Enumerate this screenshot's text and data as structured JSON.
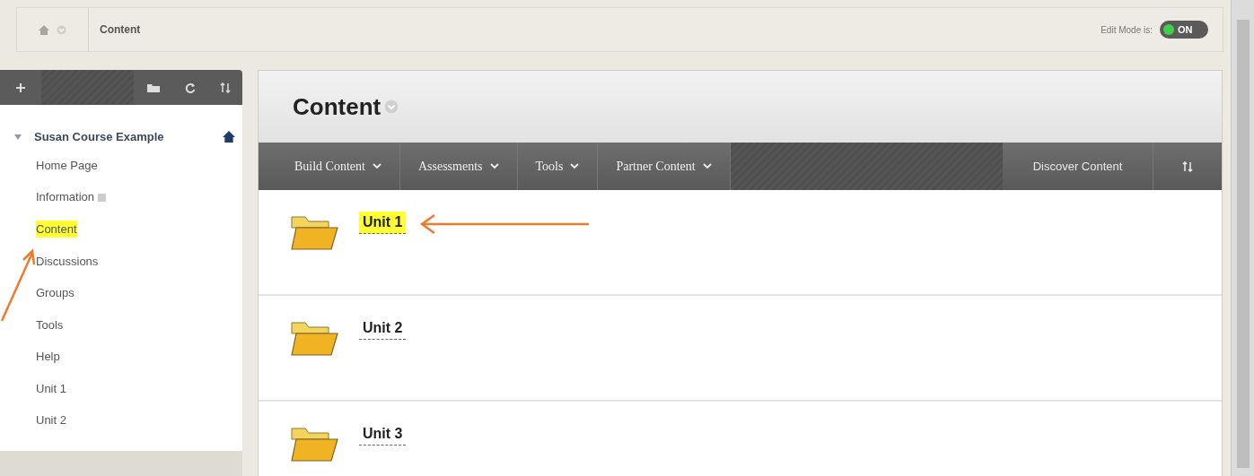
{
  "breadcrumb": {
    "current": "Content"
  },
  "edit_mode": {
    "label": "Edit Mode is:",
    "toggle": "ON",
    "on": true
  },
  "sidebar": {
    "course": {
      "title": "Susan Course Example",
      "expanded": true
    },
    "items": [
      {
        "label": "Home Page",
        "highlighted": false,
        "marker": false
      },
      {
        "label": "Information",
        "highlighted": false,
        "marker": true
      },
      {
        "label": "Content",
        "highlighted": true,
        "marker": false
      },
      {
        "label": "Discussions",
        "highlighted": false,
        "marker": false
      },
      {
        "label": "Groups",
        "highlighted": false,
        "marker": false
      },
      {
        "label": "Tools",
        "highlighted": false,
        "marker": false
      },
      {
        "label": "Help",
        "highlighted": false,
        "marker": false
      },
      {
        "label": "Unit 1",
        "highlighted": false,
        "marker": false
      },
      {
        "label": "Unit 2",
        "highlighted": false,
        "marker": false
      }
    ]
  },
  "page": {
    "title": "Content",
    "menus": [
      {
        "label": "Build Content"
      },
      {
        "label": "Assessments"
      },
      {
        "label": "Tools"
      },
      {
        "label": "Partner Content"
      }
    ],
    "discover": "Discover Content",
    "folders": [
      {
        "title": "Unit 1",
        "highlighted": true
      },
      {
        "title": "Unit 2",
        "highlighted": false
      },
      {
        "title": "Unit 3",
        "highlighted": false
      }
    ]
  }
}
